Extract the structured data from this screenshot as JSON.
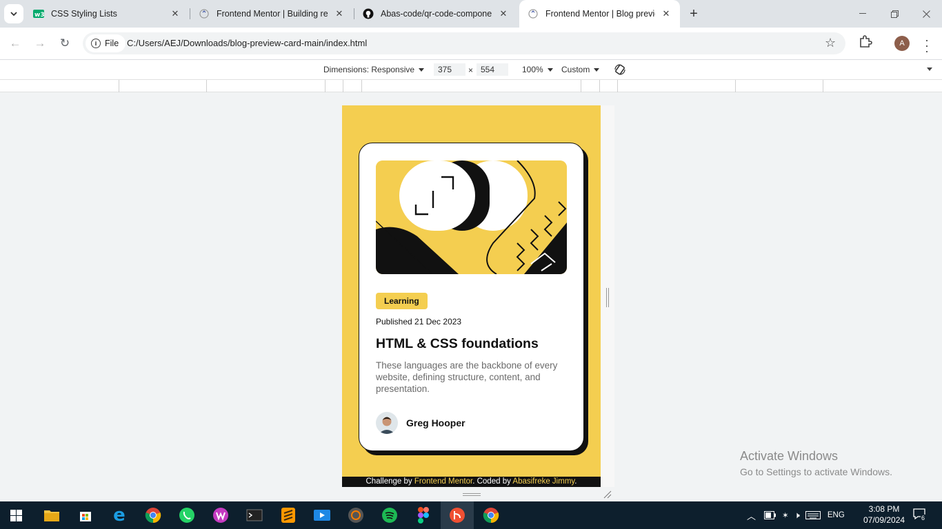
{
  "browser": {
    "tabs": [
      {
        "title": "CSS Styling Lists",
        "active": false
      },
      {
        "title": "Frontend Mentor | Building resp",
        "active": false
      },
      {
        "title": "Abas-code/qr-code-componen",
        "active": false
      },
      {
        "title": "Frontend Mentor | Blog preview",
        "active": true
      }
    ],
    "address": {
      "scheme_label": "File",
      "url": "C:/Users/AEJ/Downloads/blog-preview-card-main/index.html"
    },
    "profile_initial": "A"
  },
  "devtools": {
    "dimensions_label": "Dimensions: Responsive",
    "width": "375",
    "times": "×",
    "height": "554",
    "zoom": "100%",
    "throttle": "Custom"
  },
  "card": {
    "tag": "Learning",
    "published": "Published 21 Dec 2023",
    "title": "HTML & CSS foundations",
    "description": "These languages are the backbone of every website, defining structure, content, and presentation.",
    "author": "Greg Hooper"
  },
  "attribution": {
    "prefix": "Challenge by ",
    "link1": "Frontend Mentor",
    "middle": ". Coded by ",
    "link2": "Abasifreke Jimmy",
    "suffix": "."
  },
  "watermark": {
    "line1": "Activate Windows",
    "line2": "Go to Settings to activate Windows."
  },
  "taskbar": {
    "language": "ENG",
    "time": "3:08 PM",
    "date": "07/09/2024",
    "notification_count": "6"
  },
  "colors": {
    "accent_yellow": "#f4ce50",
    "dark": "#111111",
    "taskbar": "#0d1f2d"
  }
}
